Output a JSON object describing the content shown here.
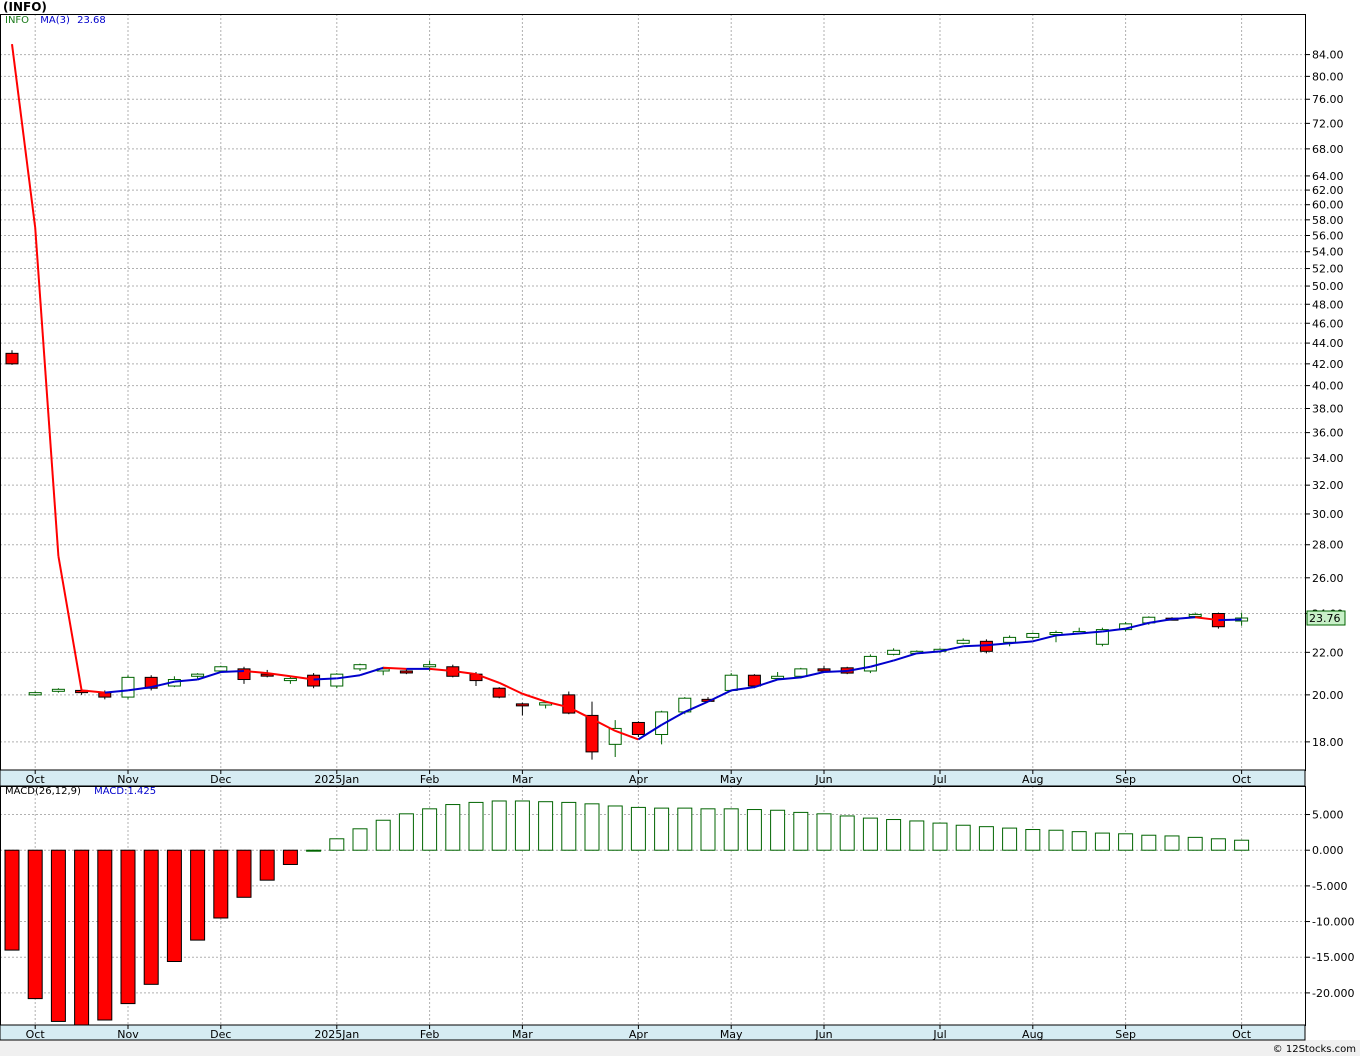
{
  "title": "(INFO)",
  "legend": {
    "symbol": "INFO",
    "ma_label": "MA(3)",
    "ma_value": "23.68",
    "macd_label": "MACD(26,12,9)",
    "macd_value": "MACD:1.425"
  },
  "last_price_tag": "23.76",
  "credit": "© 12Stocks.com",
  "colors": {
    "up_outline": "#006400",
    "down_fill": "#ff0000",
    "ma_up": "#0000cc",
    "ma_down": "#ff0000",
    "axis_band": "#d6ecf3",
    "grid": "#b0b0b0",
    "price_tag_bg": "#c8f0c8"
  },
  "chart_data": [
    {
      "type": "candlestick",
      "scale": "log",
      "ylim": [
        16.9,
        92
      ],
      "y_ticks": [
        "84.00",
        "80.00",
        "76.00",
        "72.00",
        "68.00",
        "64.00",
        "62.00",
        "60.00",
        "58.00",
        "56.00",
        "54.00",
        "52.00",
        "50.00",
        "48.00",
        "46.00",
        "44.00",
        "42.00",
        "40.00",
        "38.00",
        "36.00",
        "34.00",
        "32.00",
        "30.00",
        "28.00",
        "26.00",
        "24.00",
        "22.00",
        "20.00",
        "18.00"
      ],
      "x_labels": [
        {
          "label": "Oct",
          "index": 1
        },
        {
          "label": "Nov",
          "index": 5
        },
        {
          "label": "Dec",
          "index": 9
        },
        {
          "label": "2025Jan",
          "index": 14
        },
        {
          "label": "Feb",
          "index": 18
        },
        {
          "label": "Mar",
          "index": 22
        },
        {
          "label": "Apr",
          "index": 27
        },
        {
          "label": "May",
          "index": 31
        },
        {
          "label": "Jun",
          "index": 35
        },
        {
          "label": "Jul",
          "index": 40
        },
        {
          "label": "Aug",
          "index": 44
        },
        {
          "label": "Sep",
          "index": 48
        },
        {
          "label": "Oct",
          "index": 53
        }
      ],
      "candles": [
        {
          "o": 43.0,
          "h": 43.3,
          "l": 41.9,
          "c": 42.0
        },
        {
          "o": 20.0,
          "h": 20.15,
          "l": 19.95,
          "c": 20.1
        },
        {
          "o": 20.2,
          "h": 20.3,
          "l": 20.1,
          "c": 20.25
        },
        {
          "o": 20.2,
          "h": 20.25,
          "l": 20.0,
          "c": 20.1
        },
        {
          "o": 20.1,
          "h": 20.2,
          "l": 19.8,
          "c": 19.9
        },
        {
          "o": 19.9,
          "h": 20.9,
          "l": 19.8,
          "c": 20.8
        },
        {
          "o": 20.8,
          "h": 20.9,
          "l": 20.2,
          "c": 20.3
        },
        {
          "o": 20.4,
          "h": 20.85,
          "l": 20.35,
          "c": 20.7
        },
        {
          "o": 20.85,
          "h": 21.0,
          "l": 20.75,
          "c": 20.95
        },
        {
          "o": 21.1,
          "h": 21.35,
          "l": 21.0,
          "c": 21.3
        },
        {
          "o": 21.2,
          "h": 21.3,
          "l": 20.5,
          "c": 20.7
        },
        {
          "o": 20.95,
          "h": 21.15,
          "l": 20.8,
          "c": 20.9
        },
        {
          "o": 20.65,
          "h": 20.85,
          "l": 20.5,
          "c": 20.75
        },
        {
          "o": 20.9,
          "h": 21.0,
          "l": 20.3,
          "c": 20.4
        },
        {
          "o": 20.4,
          "h": 21.0,
          "l": 20.3,
          "c": 20.95
        },
        {
          "o": 21.2,
          "h": 21.45,
          "l": 21.1,
          "c": 21.4
        },
        {
          "o": 21.1,
          "h": 21.3,
          "l": 20.9,
          "c": 21.2
        },
        {
          "o": 21.1,
          "h": 21.2,
          "l": 20.95,
          "c": 21.05
        },
        {
          "o": 21.3,
          "h": 21.6,
          "l": 21.1,
          "c": 21.4
        },
        {
          "o": 21.3,
          "h": 21.4,
          "l": 20.8,
          "c": 20.85
        },
        {
          "o": 20.95,
          "h": 21.05,
          "l": 20.4,
          "c": 20.65
        },
        {
          "o": 20.3,
          "h": 20.35,
          "l": 19.85,
          "c": 19.9
        },
        {
          "o": 19.6,
          "h": 19.65,
          "l": 19.1,
          "c": 19.55
        },
        {
          "o": 19.55,
          "h": 19.7,
          "l": 19.4,
          "c": 19.65
        },
        {
          "o": 20.0,
          "h": 20.15,
          "l": 19.15,
          "c": 19.2
        },
        {
          "o": 19.1,
          "h": 19.7,
          "l": 17.3,
          "c": 17.6
        },
        {
          "o": 17.9,
          "h": 18.9,
          "l": 17.4,
          "c": 18.55
        },
        {
          "o": 18.8,
          "h": 18.85,
          "l": 18.2,
          "c": 18.3
        },
        {
          "o": 18.3,
          "h": 19.3,
          "l": 17.9,
          "c": 19.25
        },
        {
          "o": 19.25,
          "h": 19.9,
          "l": 19.15,
          "c": 19.85
        },
        {
          "o": 19.8,
          "h": 19.9,
          "l": 19.7,
          "c": 19.75
        },
        {
          "o": 20.2,
          "h": 21.0,
          "l": 20.15,
          "c": 20.9
        },
        {
          "o": 20.9,
          "h": 20.95,
          "l": 20.3,
          "c": 20.4
        },
        {
          "o": 20.75,
          "h": 21.05,
          "l": 20.7,
          "c": 20.85
        },
        {
          "o": 20.85,
          "h": 21.25,
          "l": 20.75,
          "c": 21.2
        },
        {
          "o": 21.2,
          "h": 21.35,
          "l": 21.05,
          "c": 21.1
        },
        {
          "o": 21.25,
          "h": 21.3,
          "l": 20.95,
          "c": 21.0
        },
        {
          "o": 21.1,
          "h": 21.9,
          "l": 21.0,
          "c": 21.8
        },
        {
          "o": 21.9,
          "h": 22.2,
          "l": 21.85,
          "c": 22.1
        },
        {
          "o": 22.0,
          "h": 22.1,
          "l": 21.95,
          "c": 22.05
        },
        {
          "o": 22.05,
          "h": 22.2,
          "l": 21.95,
          "c": 22.15
        },
        {
          "o": 22.45,
          "h": 22.7,
          "l": 22.4,
          "c": 22.6
        },
        {
          "o": 22.55,
          "h": 22.65,
          "l": 21.95,
          "c": 22.05
        },
        {
          "o": 22.5,
          "h": 22.85,
          "l": 22.3,
          "c": 22.75
        },
        {
          "o": 22.75,
          "h": 23.0,
          "l": 22.65,
          "c": 22.95
        },
        {
          "o": 22.9,
          "h": 23.1,
          "l": 22.5,
          "c": 23.0
        },
        {
          "o": 23.0,
          "h": 23.25,
          "l": 22.9,
          "c": 23.05
        },
        {
          "o": 22.4,
          "h": 23.25,
          "l": 22.3,
          "c": 23.15
        },
        {
          "o": 23.15,
          "h": 23.55,
          "l": 23.05,
          "c": 23.45
        },
        {
          "o": 23.5,
          "h": 23.85,
          "l": 23.4,
          "c": 23.8
        },
        {
          "o": 23.75,
          "h": 23.8,
          "l": 23.65,
          "c": 23.7
        },
        {
          "o": 23.85,
          "h": 24.05,
          "l": 23.75,
          "c": 23.95
        },
        {
          "o": 24.0,
          "h": 24.05,
          "l": 23.2,
          "c": 23.3
        },
        {
          "o": 23.6,
          "h": 24.05,
          "l": 23.35,
          "c": 23.76
        }
      ],
      "ma3": [
        86.0,
        57.0,
        27.3,
        20.2,
        20.1,
        20.2,
        20.35,
        20.6,
        20.7,
        21.05,
        21.1,
        21.0,
        20.85,
        20.7,
        20.75,
        20.9,
        21.25,
        21.2,
        21.2,
        21.1,
        20.95,
        20.55,
        20.05,
        19.7,
        19.45,
        18.95,
        18.45,
        18.1,
        18.7,
        19.25,
        19.7,
        20.2,
        20.35,
        20.7,
        20.8,
        21.05,
        21.1,
        21.3,
        21.6,
        21.95,
        22.05,
        22.3,
        22.35,
        22.45,
        22.55,
        22.85,
        22.95,
        23.05,
        23.2,
        23.5,
        23.7,
        23.8,
        23.65,
        23.68
      ]
    },
    {
      "type": "bar",
      "name": "MACD(26,12,9)",
      "ylim": [
        -24.5,
        9.0
      ],
      "y_ticks": [
        "5.000",
        "0.000",
        "-5.000",
        "-10.000",
        "-15.000",
        "-20.000"
      ],
      "x_labels": [
        "Oct",
        "Nov",
        "Dec",
        "2025Jan",
        "Feb",
        "Mar",
        "Apr",
        "May",
        "Jun",
        "Jul",
        "Aug",
        "Sep",
        "Oct"
      ],
      "values": [
        -14.0,
        -20.8,
        -24.0,
        -24.5,
        -23.8,
        -21.5,
        -18.8,
        -15.6,
        -12.6,
        -9.5,
        -6.6,
        -4.2,
        -2.0,
        0.0,
        1.6,
        3.0,
        4.2,
        5.1,
        5.8,
        6.4,
        6.7,
        6.9,
        6.9,
        6.8,
        6.7,
        6.5,
        6.2,
        6.0,
        5.9,
        5.9,
        5.8,
        5.8,
        5.7,
        5.6,
        5.3,
        5.1,
        4.8,
        4.5,
        4.3,
        4.1,
        3.8,
        3.5,
        3.3,
        3.1,
        2.9,
        2.8,
        2.6,
        2.4,
        2.3,
        2.1,
        2.0,
        1.8,
        1.6,
        1.4
      ]
    }
  ]
}
